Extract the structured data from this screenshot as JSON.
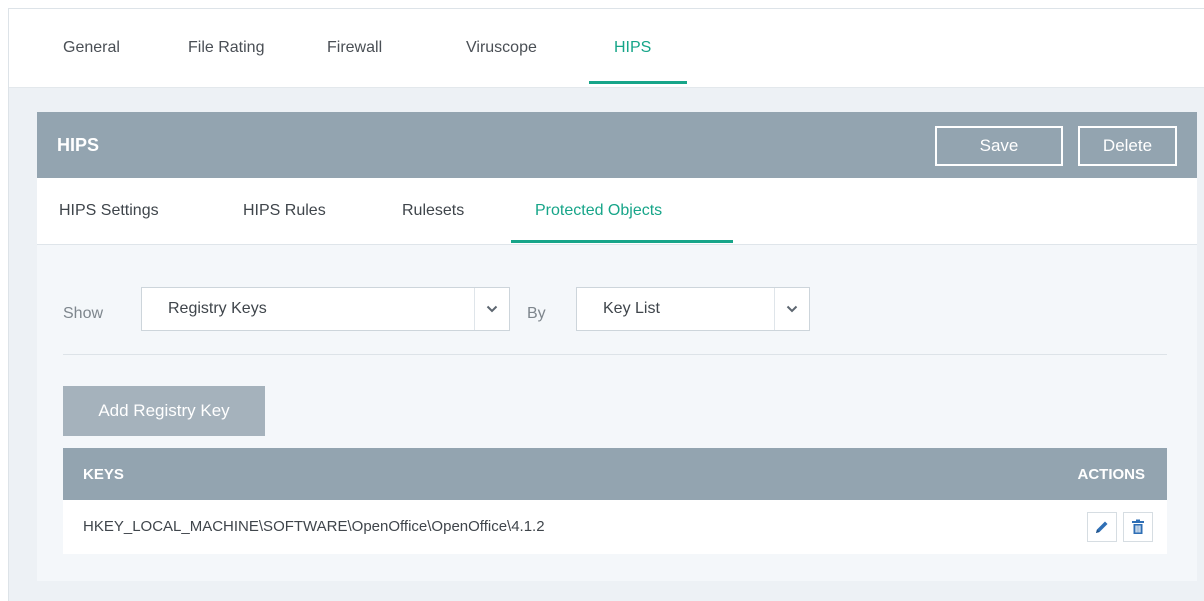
{
  "top_tabs": [
    {
      "label": "General"
    },
    {
      "label": "File Rating"
    },
    {
      "label": "Firewall"
    },
    {
      "label": "Viruscope"
    },
    {
      "label": "HIPS"
    }
  ],
  "active_top_tab": "HIPS",
  "hips_bar": {
    "title": "HIPS",
    "save_label": "Save",
    "delete_label": "Delete"
  },
  "sub_tabs": [
    {
      "label": "HIPS Settings"
    },
    {
      "label": "HIPS Rules"
    },
    {
      "label": "Rulesets"
    },
    {
      "label": "Protected Objects"
    }
  ],
  "active_sub_tab": "Protected Objects",
  "filters": {
    "show_label": "Show",
    "show_value": "Registry Keys",
    "by_label": "By",
    "by_value": "Key List"
  },
  "add_button_label": "Add Registry Key",
  "table": {
    "columns": [
      "KEYS",
      "ACTIONS"
    ],
    "rows": [
      {
        "key": "HKEY_LOCAL_MACHINE\\SOFTWARE\\OpenOffice\\OpenOffice\\4.1.2"
      }
    ]
  },
  "icons": {
    "edit": "pencil-icon",
    "delete": "trash-icon",
    "dropdown": "chevron-down-icon"
  },
  "colors": {
    "accent": "#17a589",
    "header_bar": "#93a4b0",
    "action_icon": "#2f6fb5"
  }
}
